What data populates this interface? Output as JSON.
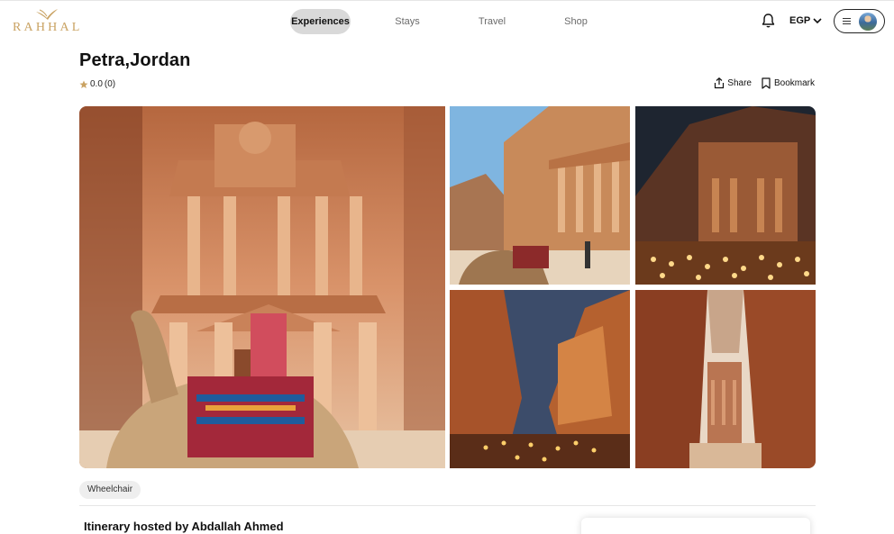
{
  "brand": {
    "name": "RAHHAL",
    "logo_icon": "bird-logo-icon",
    "color": "#c9a262"
  },
  "nav": {
    "items": [
      {
        "label": "Experiences",
        "active": true
      },
      {
        "label": "Stays",
        "active": false
      },
      {
        "label": "Travel",
        "active": false
      },
      {
        "label": "Shop",
        "active": false
      }
    ]
  },
  "header": {
    "notification_icon": "bell-icon",
    "currency": "EGP",
    "menu_icon": "hamburger-icon",
    "avatar_icon": "user-avatar"
  },
  "listing": {
    "title": "Petra,Jordan",
    "rating": "0.0",
    "reviews": "(0)",
    "share_label": "Share",
    "bookmark_label": "Bookmark",
    "accessibility_tag": "Wheelchair",
    "host_heading": "Itinerary hosted by Abdallah Ahmed"
  },
  "gallery": {
    "photos": [
      "Treasury facade with camel",
      "Treasury with camels and tourists",
      "Treasury at night with candles",
      "Canyon at night with lights",
      "Siq canyon view of Treasury"
    ]
  },
  "colors": {
    "accent": "#c9a262",
    "nav_active_bg": "#d9d9d9",
    "star": "#c9a262"
  }
}
